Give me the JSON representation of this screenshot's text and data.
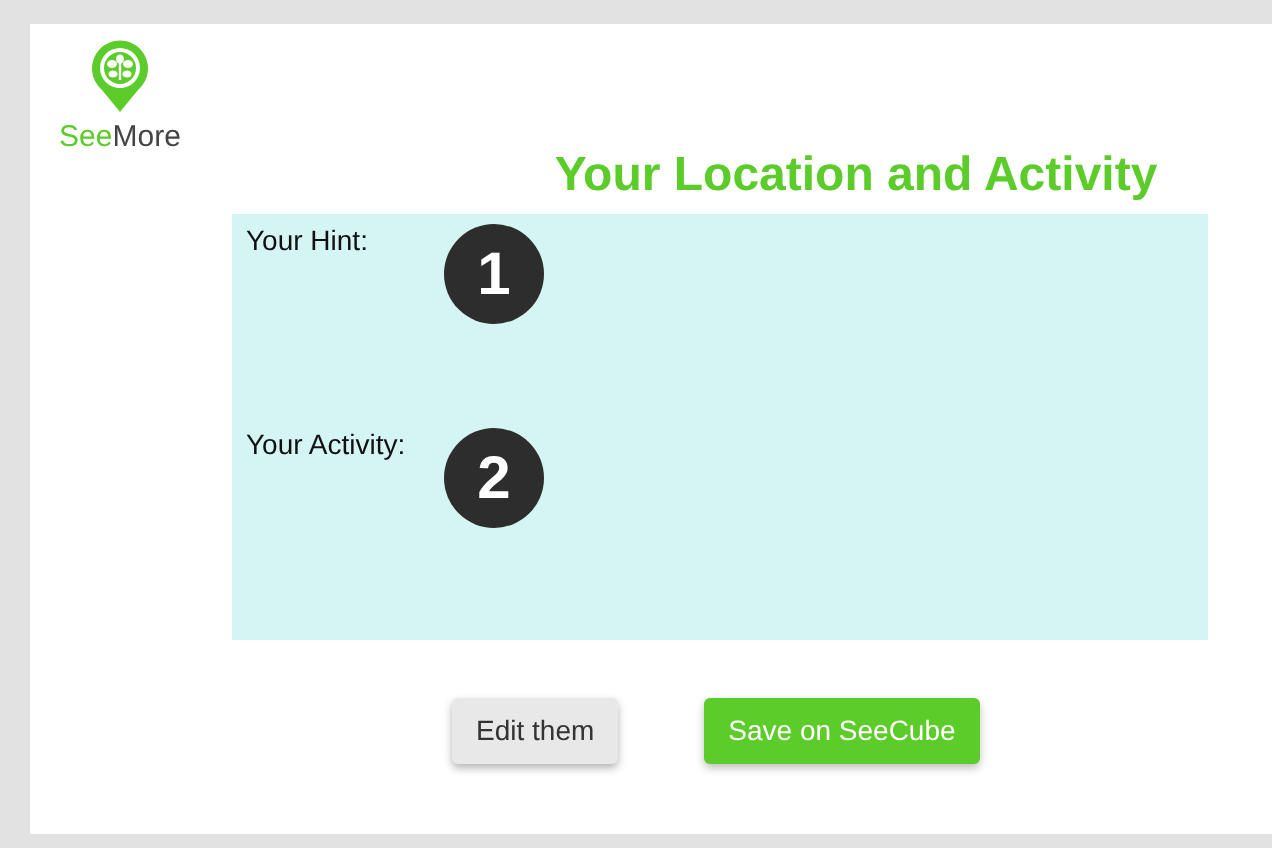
{
  "logo": {
    "lead": "See",
    "rest": "More"
  },
  "title": "Your Location and Activity",
  "fields": [
    {
      "label": "Your Hint:",
      "marker": "1"
    },
    {
      "label": "Your Activity:",
      "marker": "2"
    }
  ],
  "buttons": [
    {
      "label": "Edit them",
      "kind": "secondary"
    },
    {
      "label": "Save on SeeCube",
      "kind": "primary"
    }
  ]
}
